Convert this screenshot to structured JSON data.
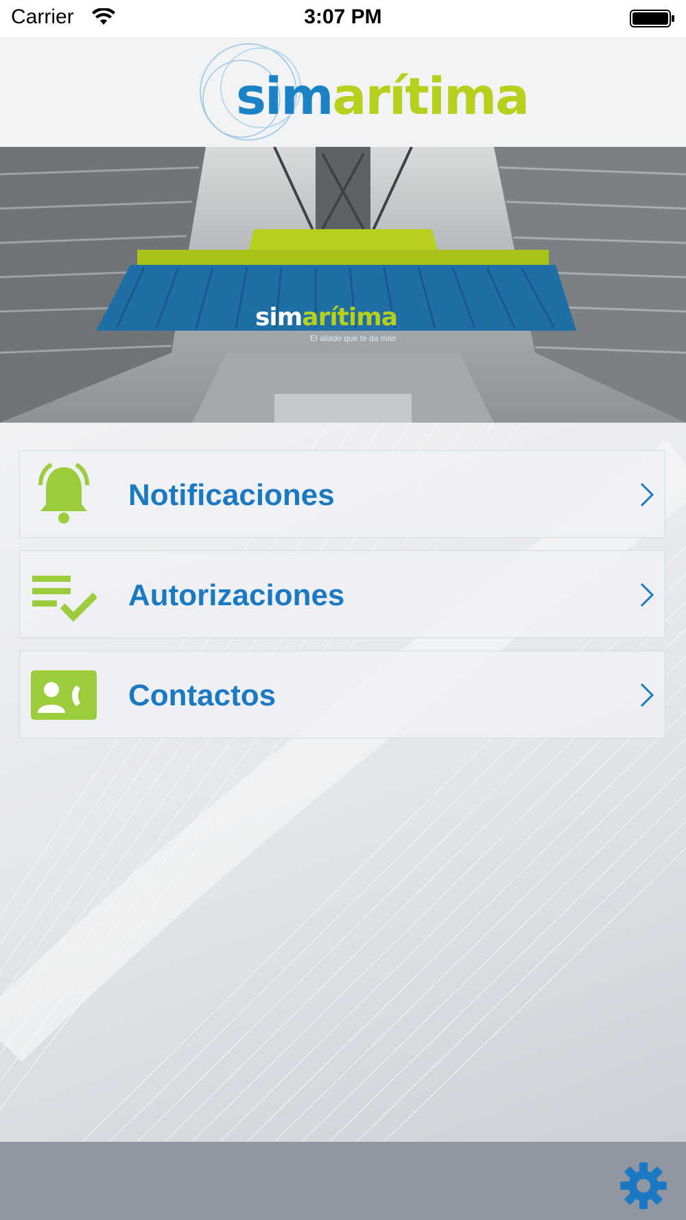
{
  "status_bar": {
    "carrier": "Carrier",
    "time": "3:07 PM"
  },
  "header": {
    "logo_sim": "sim",
    "logo_rest": "arítima"
  },
  "hero": {
    "container_label_white": "sim",
    "container_label_green": "arítima",
    "container_tagline": "El aliado que te da más"
  },
  "menu": {
    "items": [
      {
        "label": "Notificaciones",
        "icon": "bell-icon"
      },
      {
        "label": "Autorizaciones",
        "icon": "checklist-icon"
      },
      {
        "label": "Contactos",
        "icon": "contact-card-icon"
      }
    ]
  },
  "footer": {
    "settings_icon": "gear-icon"
  },
  "colors": {
    "brand_blue": "#1b79c4",
    "brand_green": "#9ccb3b",
    "bottom_bar": "#8f96a2"
  }
}
